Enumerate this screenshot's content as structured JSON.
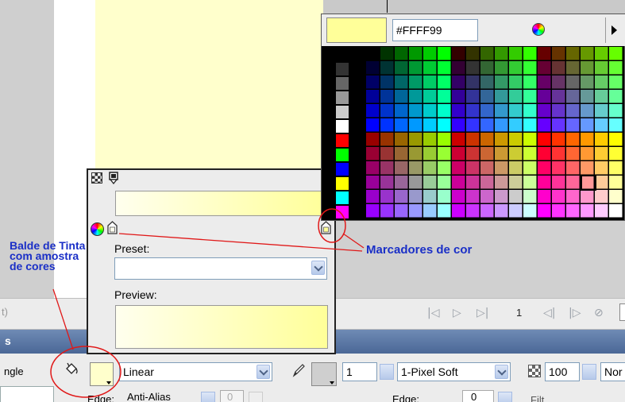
{
  "hex_value": "#FFFF99",
  "gradient_panel": {
    "preset_label": "Preset:",
    "preview_label": "Preview:"
  },
  "timeline": {
    "left_text": "t)",
    "frame_number": "1"
  },
  "properties": {
    "title": "s",
    "tool_name": "ngle",
    "fill_type": "Linear",
    "fill_edge_label": "Edge:",
    "fill_edge_value": "Anti-Alias",
    "fill_edge_number": "0",
    "stroke_width": "1",
    "stroke_style": "1-Pixel Soft",
    "stroke_edge_label": "Edge:",
    "stroke_edge_number": "0",
    "alpha_value": "100",
    "blend_value": "Nor",
    "filter_label": "Filt"
  },
  "annotations": {
    "bucket_note": "Balde de Tinta com amostra de cores",
    "markers_note": "Marcadores de cor"
  },
  "icons": {
    "bucket": "paint-bucket-icon",
    "pencil": "pencil-icon",
    "wheel": "color-wheel-icon",
    "menu": "triangle-right-icon",
    "alpha": "checkerboard-icon"
  },
  "colors": {
    "fill": "#FFFFCC",
    "selected": "#FFFF99",
    "annotation_text": "#1A2FC7",
    "annotation_line": "#E01818",
    "header": "#4A6796"
  }
}
